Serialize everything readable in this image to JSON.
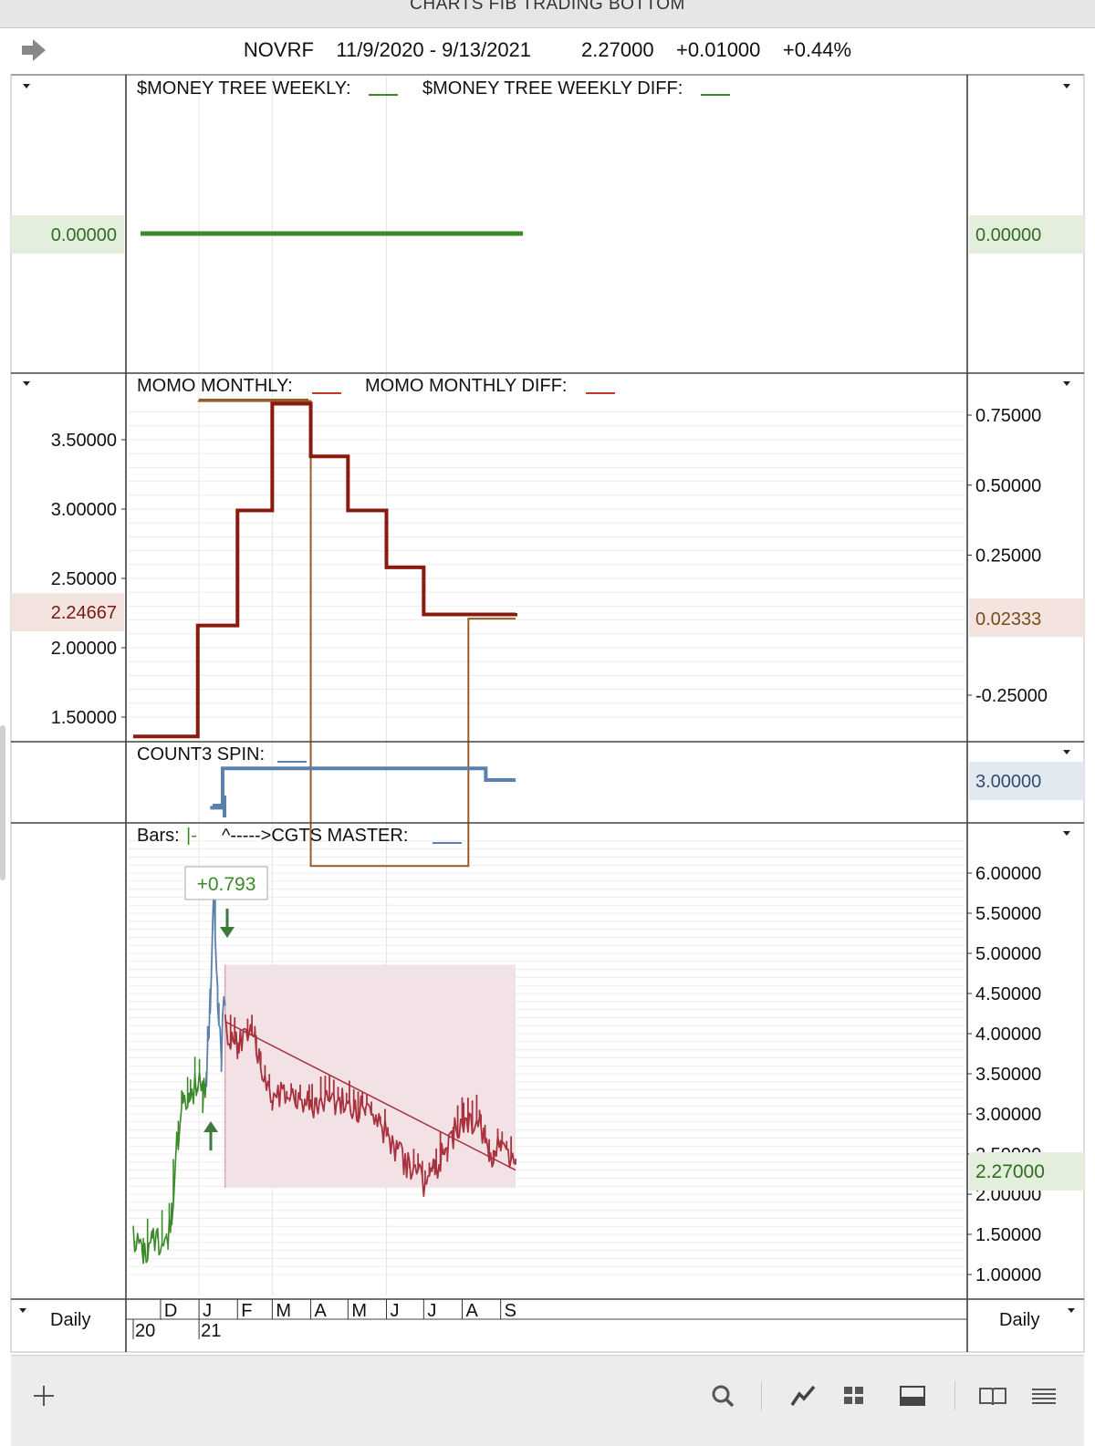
{
  "window": {
    "title": "CHARTS FIB TRADING BOTTOM"
  },
  "header": {
    "symbol": "NOVRF",
    "date_range": "11/9/2020 - 9/13/2021",
    "last": "2.27000",
    "change": "+0.01000",
    "change_pct": "+0.44%"
  },
  "panels": {
    "money_tree": {
      "label1": "$MONEY TREE WEEKLY:",
      "label2": "$MONEY TREE WEEKLY DIFF:",
      "left_badge": "0.00000",
      "right_badge": "0.00000"
    },
    "momo": {
      "label1": "MOMO MONTHLY:",
      "label2": "MOMO MONTHLY DIFF:",
      "left_badge": "2.24667",
      "right_badge": "0.02333"
    },
    "count3": {
      "label": "COUNT3 SPIN:",
      "right_badge": "3.00000"
    },
    "price": {
      "label_bars": "Bars:",
      "label_bars_suffix": "|-",
      "label_master": "^----->CGTS MASTER:",
      "callout": "+0.793",
      "right_badge": "2.27000"
    }
  },
  "footer": {
    "period_left": "Daily",
    "period_right": "Daily"
  },
  "colors": {
    "green": "#3a8a2a",
    "momo": "#8b1a0e",
    "momo_diff": "#9a5b24",
    "count3": "#5b80ad",
    "bear": "#a8323e",
    "zone": "#f3e2e5",
    "badge_green": "#e3eedd",
    "badge_brown": "#f3e4df",
    "badge_blue": "#e3e9f1"
  },
  "toolbar_icons": [
    "plus-icon",
    "search-icon",
    "draw-line-icon",
    "grid-layout-icon",
    "panel-layout-icon",
    "book-icon",
    "menu-icon"
  ],
  "chart_data": [
    {
      "type": "line",
      "title": "$MONEY TREE WEEKLY",
      "y_ticks": [],
      "x_start": "2020-11-09",
      "x_end": "2021-09-13",
      "series": [
        {
          "name": "$MONEY TREE WEEKLY",
          "color": "#3a8a2a",
          "points": [
            [
              "2020-11-09",
              0.0
            ],
            [
              "2021-09-13",
              0.0
            ]
          ]
        }
      ]
    },
    {
      "type": "line",
      "title": "MOMO MONTHLY",
      "y_ticks": [
        1.5,
        2.0,
        2.5,
        3.0,
        3.5
      ],
      "y2_ticks": [
        -0.25,
        0.25,
        0.5,
        0.75
      ],
      "series": [
        {
          "name": "MOMO MONTHLY",
          "step": true,
          "color": "#8b1a0e",
          "points": [
            [
              "2020-11-09",
              1.36
            ],
            [
              "2020-12-31",
              2.16
            ],
            [
              "2021-02-01",
              2.99
            ],
            [
              "2021-03-01",
              3.76
            ],
            [
              "2021-04-01",
              3.38
            ],
            [
              "2021-05-01",
              2.99
            ],
            [
              "2021-06-01",
              2.58
            ],
            [
              "2021-07-01",
              2.24
            ],
            [
              "2021-09-13",
              2.25
            ]
          ]
        },
        {
          "name": "MOMO MONTHLY DIFF",
          "step": true,
          "color": "#9a5b24",
          "points": [
            [
              "2020-12-31",
              0.8
            ],
            [
              "2021-04-01",
              -0.86
            ],
            [
              "2021-08-06",
              0.02333
            ],
            [
              "2021-09-13",
              0.02333
            ]
          ]
        }
      ]
    },
    {
      "type": "line",
      "title": "COUNT3 SPIN",
      "y_ticks": [],
      "series": [
        {
          "name": "COUNT3 SPIN",
          "step": true,
          "color": "#5b80ad",
          "points": [
            [
              "2021-01-10",
              1.1
            ],
            [
              "2021-01-20",
              3.8
            ],
            [
              "2021-08-20",
              3.0
            ],
            [
              "2021-09-13",
              3.0
            ]
          ]
        }
      ]
    },
    {
      "type": "bar",
      "title": "Bars / CGTS MASTER",
      "y_ticks": [
        1.0,
        1.5,
        2.0,
        2.5,
        3.0,
        3.5,
        4.0,
        4.5,
        5.0,
        5.5,
        6.0
      ],
      "x_tick_labels": [
        "D",
        "J",
        "F",
        "M",
        "A",
        "M",
        "J",
        "J",
        "A",
        "S"
      ],
      "x_tick_dates": [
        "2020-12-01",
        "2021-01-01",
        "2021-02-01",
        "2021-03-01",
        "2021-04-01",
        "2021-05-01",
        "2021-06-01",
        "2021-07-01",
        "2021-08-01",
        "2021-09-01"
      ],
      "year_labels": [
        {
          "label": "20",
          "date": "2020-11-09"
        },
        {
          "label": "21",
          "date": "2021-01-01"
        }
      ],
      "series": [
        {
          "name": "price (up phase)",
          "color": "#3a8a2a",
          "points": [
            [
              "2020-11-09",
              1.43
            ],
            [
              "2020-11-16",
              1.3
            ],
            [
              "2020-11-24",
              1.35
            ],
            [
              "2020-12-01",
              1.38
            ],
            [
              "2020-12-07",
              1.45
            ],
            [
              "2020-12-10",
              1.8
            ],
            [
              "2020-12-14",
              2.6
            ],
            [
              "2020-12-18",
              3.1
            ],
            [
              "2020-12-24",
              3.2
            ],
            [
              "2020-12-31",
              3.4
            ],
            [
              "2021-01-04",
              3.2
            ],
            [
              "2021-01-07",
              3.4
            ]
          ]
        },
        {
          "name": "price (spike)",
          "color": "#5b80ad",
          "points": [
            [
              "2021-01-07",
              3.4
            ],
            [
              "2021-01-10",
              4.3
            ],
            [
              "2021-01-13",
              5.9
            ],
            [
              "2021-01-16",
              4.6
            ],
            [
              "2021-01-19",
              3.8
            ],
            [
              "2021-01-22",
              4.5
            ]
          ]
        },
        {
          "name": "price (decline)",
          "color": "#a8323e",
          "points": [
            [
              "2021-01-22",
              4.1
            ],
            [
              "2021-02-01",
              3.85
            ],
            [
              "2021-02-15",
              3.95
            ],
            [
              "2021-03-01",
              3.15
            ],
            [
              "2021-03-15",
              3.3
            ],
            [
              "2021-04-01",
              3.1
            ],
            [
              "2021-04-15",
              3.2
            ],
            [
              "2021-05-01",
              3.15
            ],
            [
              "2021-05-15",
              3.0
            ],
            [
              "2021-06-01",
              2.75
            ],
            [
              "2021-06-15",
              2.4
            ],
            [
              "2021-07-01",
              2.15
            ],
            [
              "2021-07-10",
              2.3
            ],
            [
              "2021-07-20",
              2.6
            ],
            [
              "2021-08-01",
              2.95
            ],
            [
              "2021-08-15",
              2.9
            ],
            [
              "2021-08-25",
              2.5
            ],
            [
              "2021-09-01",
              2.7
            ],
            [
              "2021-09-13",
              2.27
            ]
          ]
        },
        {
          "name": "trendline",
          "color": "#a8323e",
          "points": [
            [
              "2021-01-22",
              4.15
            ],
            [
              "2021-09-13",
              2.3
            ]
          ]
        }
      ],
      "zone": {
        "x_start": "2021-01-22",
        "x_end": "2021-09-13",
        "y_low": 2.08,
        "y_high": 4.86
      }
    }
  ]
}
